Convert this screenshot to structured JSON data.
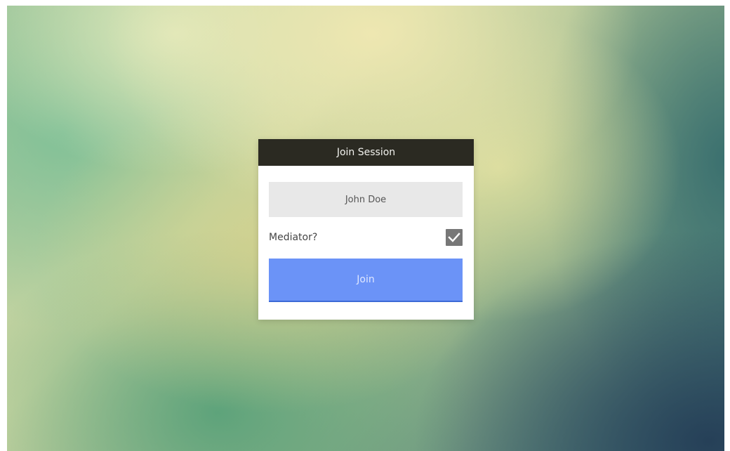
{
  "dialog": {
    "title": "Join Session",
    "name_input": {
      "value": "John Doe"
    },
    "mediator": {
      "label": "Mediator?",
      "checked": true,
      "checkbox_icon": "checkmark-icon"
    },
    "join_button": {
      "label": "Join"
    }
  },
  "colors": {
    "header_bg": "#2b2a22",
    "input_bg": "#e8e8e8",
    "checkbox_bg": "#777777",
    "join_button_bg": "#6b93f7"
  }
}
